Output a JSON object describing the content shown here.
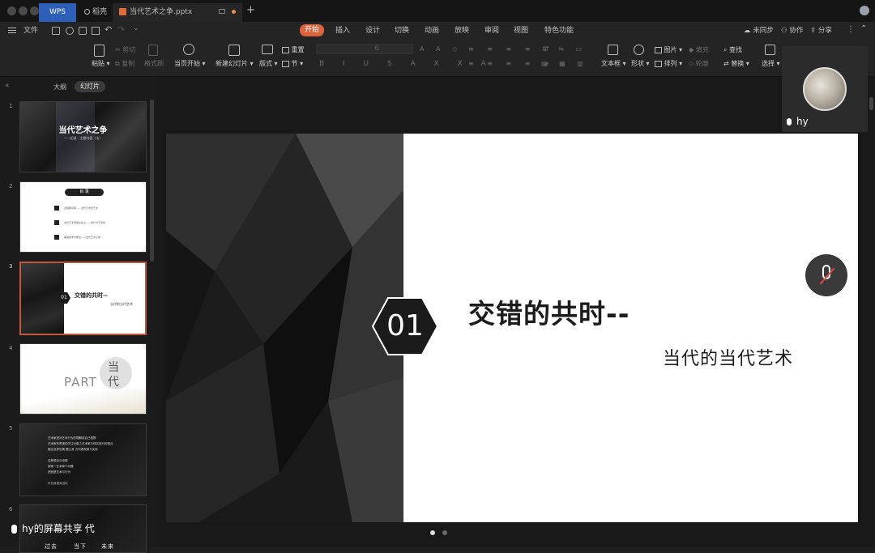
{
  "titlebar": {
    "wps_tab": "WPS",
    "home_tab": "稻壳",
    "doc_tab": "当代艺术之争.pptx"
  },
  "menubar": {
    "file": "文件",
    "tabs": [
      "开始",
      "插入",
      "设计",
      "切换",
      "动画",
      "放映",
      "审阅",
      "视图",
      "特色功能"
    ],
    "active_tab": "开始",
    "sync": "未同步",
    "collab": "协作",
    "share": "分享"
  },
  "ribbon": {
    "paste": "粘贴",
    "cut": "剪切",
    "copy": "复制",
    "format_painter": "格式刷",
    "start_from_current": "当页开始",
    "new_slide": "新建幻灯片",
    "layout": "版式",
    "section": "节",
    "reset": "重置",
    "font_size": "0",
    "text_box": "文本框",
    "shape": "形状",
    "picture": "图片",
    "fill": "填充",
    "arrange": "排列",
    "outline": "轮廓",
    "find": "查找",
    "replace": "替换",
    "select": "选择"
  },
  "panel": {
    "outline_tab": "大纲",
    "slides_tab": "幻灯片",
    "thumbs": [
      {
        "num": "1",
        "title": "当代艺术之争",
        "sub": "——纪录 · 主题内容（法）"
      },
      {
        "num": "2",
        "title": "目 录",
        "items": [
          "四幕剧序幕——当代艺术化艺术",
          "当代艺术观照点在之——世行为艺术时",
          "美丽的学术概念——当代艺术之争"
        ]
      },
      {
        "num": "3",
        "badge": "01",
        "title": "交错的共时--",
        "sub": "当代的当代艺术"
      },
      {
        "num": "4",
        "part": "PART",
        "chars": [
          "当",
          "代"
        ]
      },
      {
        "num": "5",
        "lines": [
          "艺术家把对艺术行为的理解成自己视野",
          "艺术家有思维的关注对象之艺术家与现实进行的视点",
          "融合这样也情 题之身 方向表现美与实际",
          "这种想法与设想",
          "即某一艺术家个问题",
          "把就是艺术与行为",
          "行为并说对当代"
        ]
      },
      {
        "num": "6",
        "lines": [
          "过去",
          "当下",
          "未来"
        ]
      }
    ]
  },
  "slide": {
    "badge_number": "01",
    "title": "交错的共时--",
    "subtitle": "当代的当代艺术"
  },
  "video": {
    "name": "hy"
  },
  "screen_share_label": "hy的屏幕共享",
  "screen_share_tail": "代",
  "pager": {
    "current": 1,
    "total": 2
  }
}
